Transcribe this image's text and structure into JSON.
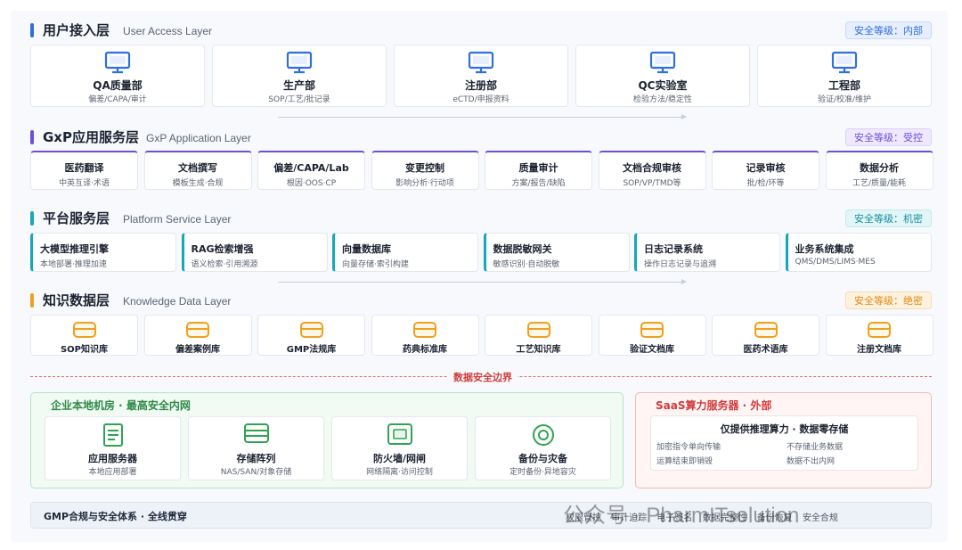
{
  "colors": {
    "blue": "#2f6fe0",
    "purple": "#6d4fd6",
    "teal": "#16a7b9",
    "orange": "#f0a020",
    "green": "#2ea44f",
    "red": "#d13b3b"
  },
  "layers": [
    {
      "title": "用户接入层",
      "subtitle": "User Access Layer",
      "badge": "安全等级：内部",
      "items": [
        {
          "name": "QA质量部",
          "desc": "偏差/CAPA/审计"
        },
        {
          "name": "生产部",
          "desc": "SOP/工艺/批记录"
        },
        {
          "name": "注册部",
          "desc": "eCTD/申报资料"
        },
        {
          "name": "QC实验室",
          "desc": "检验方法/稳定性"
        },
        {
          "name": "工程部",
          "desc": "验证/校准/维护"
        }
      ]
    },
    {
      "title": "GxP应用服务层",
      "subtitle": "GxP Application Layer",
      "badge": "安全等级：受控",
      "items": [
        {
          "name": "医药翻译",
          "desc": "中英互译·术语"
        },
        {
          "name": "文档撰写",
          "desc": "模板生成·合规"
        },
        {
          "name": "偏差/CAPA/Lab",
          "desc": "根因·OOS·CP"
        },
        {
          "name": "变更控制",
          "desc": "影响分析·行动项"
        },
        {
          "name": "质量审计",
          "desc": "方案/报告/缺陷"
        },
        {
          "name": "文档合规审核",
          "desc": "SOP/VP/TMD等"
        },
        {
          "name": "记录审核",
          "desc": "批/检/环等"
        },
        {
          "name": "数据分析",
          "desc": "工艺/质量/能耗"
        }
      ]
    },
    {
      "title": "平台服务层",
      "subtitle": "Platform Service Layer",
      "badge": "安全等级：机密",
      "items": [
        {
          "name": "大模型推理引擎",
          "desc": "本地部署·推理加速"
        },
        {
          "name": "RAG检索增强",
          "desc": "语义检索·引用溯源"
        },
        {
          "name": "向量数据库",
          "desc": "向量存储·索引构建"
        },
        {
          "name": "数据脱敏网关",
          "desc": "敏感识别·自动脱敏"
        },
        {
          "name": "日志记录系统",
          "desc": "操作日志记录与追溯"
        },
        {
          "name": "业务系统集成",
          "desc": "QMS/DMS/LIMS·MES"
        }
      ]
    },
    {
      "title": "知识数据层",
      "subtitle": "Knowledge Data Layer",
      "badge": "安全等级：绝密",
      "items": [
        {
          "name": "SOP知识库"
        },
        {
          "name": "偏差案例库"
        },
        {
          "name": "GMP法规库"
        },
        {
          "name": "药典标准库"
        },
        {
          "name": "工艺知识库"
        },
        {
          "name": "验证文档库"
        },
        {
          "name": "医药术语库"
        },
        {
          "name": "注册文档库"
        }
      ]
    }
  ],
  "boundary": {
    "label": "数据安全边界"
  },
  "onprem": {
    "title": "企业本地机房 · 最高安全内网",
    "items": [
      {
        "name": "应用服务器",
        "desc": "本地应用部署"
      },
      {
        "name": "存储阵列",
        "desc": "NAS/SAN/对象存储"
      },
      {
        "name": "防火墙/网闸",
        "desc": "网络隔离·访问控制"
      },
      {
        "name": "备份与灾备",
        "desc": "定时备份·异地容灾"
      }
    ]
  },
  "saas": {
    "title": "SaaS算力服务器 · 外部",
    "heading": "仅提供推理算力 · 数据零存储",
    "points": [
      "加密指令单向传输",
      "不存储业务数据",
      "运算结束即销毁",
      "数据不出内网"
    ]
  },
  "footer": {
    "title": "GMP合规与安全体系 · 全线贯穿",
    "tags": [
      "权限管控",
      "审计追踪",
      "电子签名",
      "数据完整性",
      "备份恢复",
      "安全合规"
    ]
  },
  "watermark": "公众号 · PharmITsolution"
}
